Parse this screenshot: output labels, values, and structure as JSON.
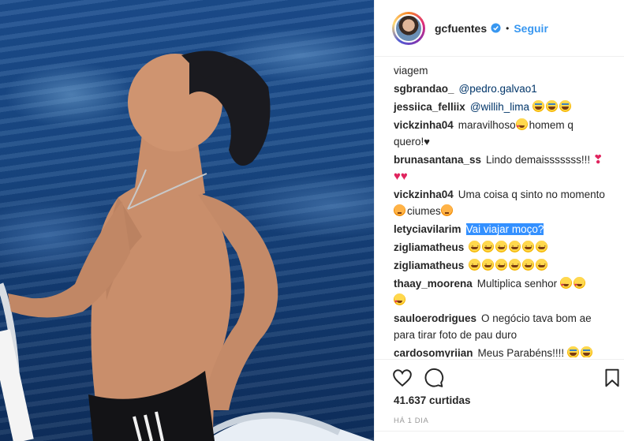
{
  "post": {
    "username": "gcfuentes",
    "follow_label": "Seguir",
    "separator": "•"
  },
  "comments": [
    {
      "user": "",
      "text": "viagem"
    },
    {
      "user": "sgbrandao_",
      "mention": "@pedro.galvao1"
    },
    {
      "user": "jessiica_felliix",
      "mention": "@willih_lima"
    },
    {
      "user": "vickzinha04",
      "text_a": "maravilhoso",
      "text_b": "homem q quero!"
    },
    {
      "user": "brunasantana_ss",
      "text": "Lindo demaisssssss!!!"
    },
    {
      "user": "vickzinha04",
      "text_a": "Uma coisa q sinto no momento",
      "text_b": "ciumes"
    },
    {
      "user": "letyciavilarim",
      "highlight": "Vai viajar moço?"
    },
    {
      "user": "zigliamatheus"
    },
    {
      "user": "zigliamatheus"
    },
    {
      "user": "thaay_moorena",
      "text": "Multiplica senhor"
    },
    {
      "user": "sauloerodrigues",
      "text": "O negócio tava bom ae para tirar foto de pau duro"
    },
    {
      "user": "cardosomyriian",
      "text": "Meus Parabéns!!!!"
    }
  ],
  "stats": {
    "likes": "41.637 curtidas",
    "time": "HÁ 1 DIA"
  },
  "icons": {
    "like": "heart-outline-icon",
    "comment": "speech-bubble-icon",
    "save": "bookmark-icon",
    "verified": "verified-badge-icon"
  },
  "colors": {
    "link": "#3897f0",
    "mention": "#003569",
    "highlight": "#3390ff"
  }
}
